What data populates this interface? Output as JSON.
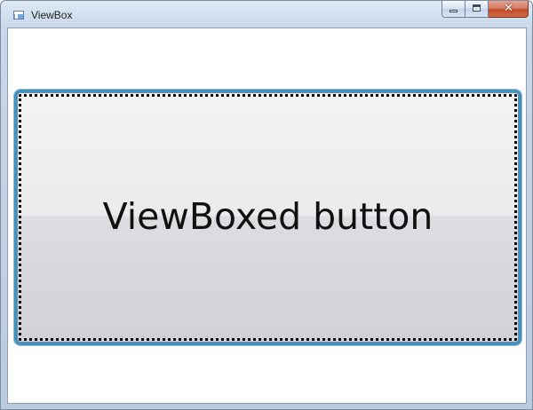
{
  "window": {
    "title": "ViewBox",
    "caption_buttons": {
      "minimize_icon": "minimize-icon",
      "maximize_icon": "maximize-icon",
      "close_icon": "close-icon",
      "close_glyph": "✕"
    }
  },
  "content": {
    "button_label": "ViewBoxed button"
  },
  "colors": {
    "button_border": "#3c93c6",
    "close_button": "#c14b2b"
  }
}
